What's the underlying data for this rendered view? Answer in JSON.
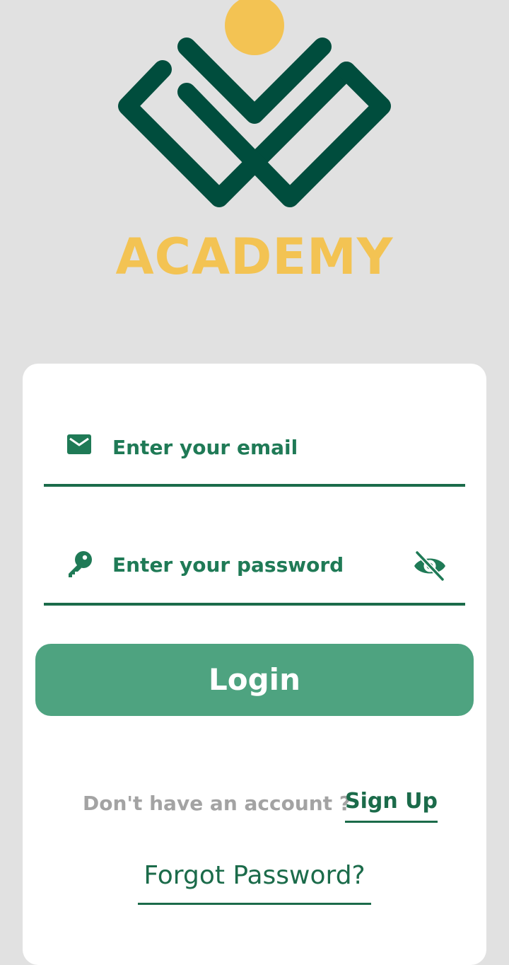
{
  "brand": {
    "name": "ACADEMY",
    "primary_color": "#004d3d",
    "accent_color": "#f3c353"
  },
  "form": {
    "email": {
      "placeholder": "Enter your email",
      "icon": "mail-icon"
    },
    "password": {
      "placeholder": "Enter your password",
      "icon": "key-icon",
      "visibility_icon": "eye-off-icon"
    },
    "login_label": "Login"
  },
  "footer": {
    "signup_prompt": "Don't have an account ?",
    "signup_label": "Sign Up",
    "forgot_label": "Forgot Password?"
  }
}
